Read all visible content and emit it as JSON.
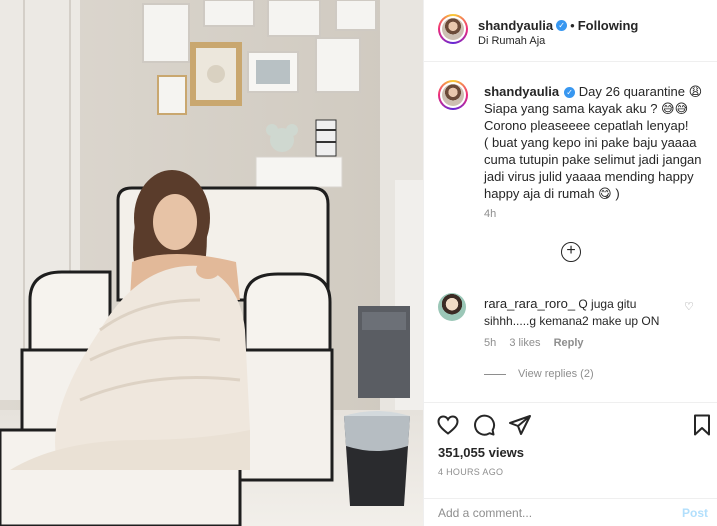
{
  "post": {
    "username": "shandyaulia",
    "verified_icon": "verified-badge-icon",
    "separator": "•",
    "follow_label": "Following",
    "location": "Di Rumah Aja",
    "caption_lines": [
      "Day 26 quarantine 😩",
      "Siapa yang sama kayak aku ? 😅😅",
      "Corono pleaseeee cepatlah lenyap!",
      "( buat yang kepo ini pake baju yaaaa cuma tutupin pake selimut jadi jangan jadi virus julid yaaaa mending happy happy aja di rumah 😋 )"
    ],
    "caption_time": "4h",
    "load_more_icon": "plus-circle-icon"
  },
  "comment": {
    "username": "rara_rara_roro_",
    "text": "Q juga gitu sihhh.....g kemana2 make up ON",
    "time": "5h",
    "likes": "3 likes",
    "reply_label": "Reply",
    "view_replies": "View replies (2)",
    "heart_icon": "heart-outline-icon"
  },
  "actions": {
    "icons": [
      "heart-icon",
      "comment-icon",
      "share-icon",
      "bookmark-icon"
    ],
    "views": "351,055 views",
    "timestamp": "4 HOURS AGO"
  },
  "composer": {
    "placeholder": "Add a comment...",
    "post_label": "Post"
  },
  "colors": {
    "link_blue": "#3897f0",
    "post_disabled": "#b2dffc",
    "meta_gray": "#8e8e8e"
  }
}
